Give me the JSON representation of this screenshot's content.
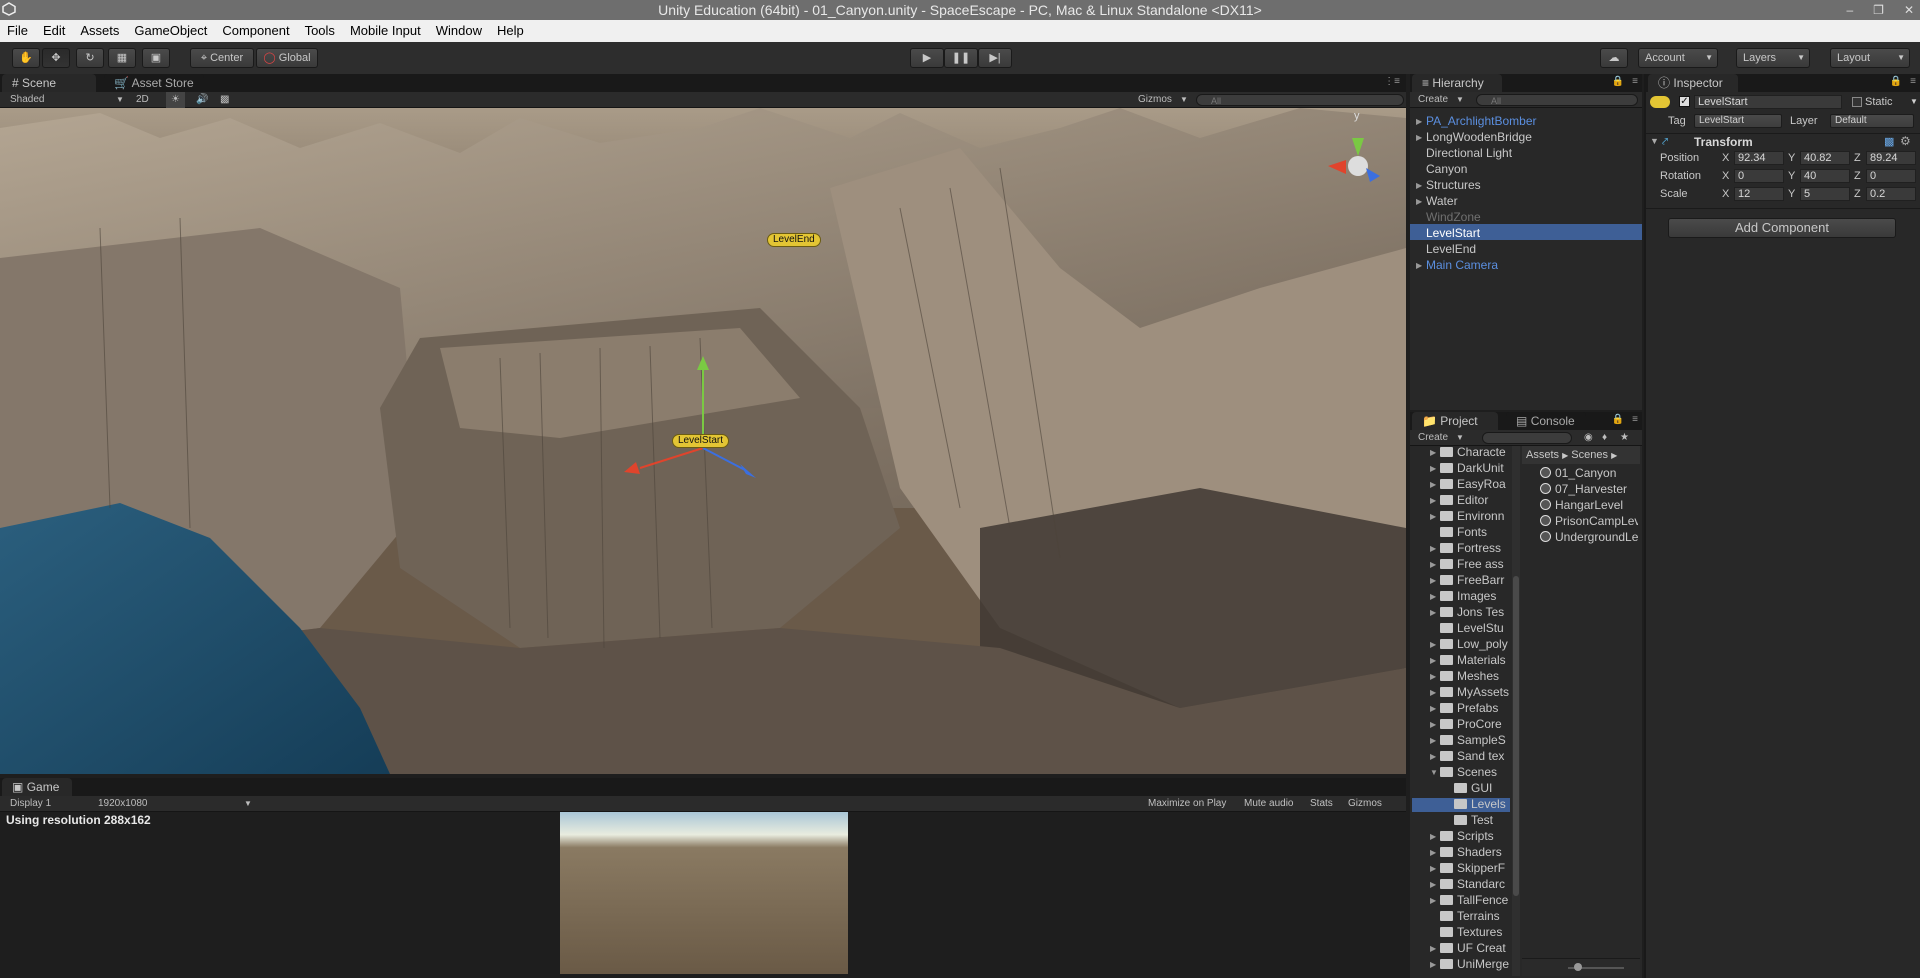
{
  "window": {
    "title": "Unity Education (64bit) - 01_Canyon.unity - SpaceEscape - PC, Mac & Linux Standalone <DX11>"
  },
  "menu": [
    "File",
    "Edit",
    "Assets",
    "GameObject",
    "Component",
    "Tools",
    "Mobile Input",
    "Window",
    "Help"
  ],
  "toolbar": {
    "center": "Center",
    "global": "Global",
    "account": "Account",
    "layers": "Layers",
    "layout": "Layout"
  },
  "scene": {
    "tab_scene": "Scene",
    "tab_store": "Asset Store",
    "shading": "Shaded",
    "mode2d": "2D",
    "gizmos": "Gizmos",
    "search": "All",
    "label_start": "LevelStart",
    "label_end": "LevelEnd",
    "axis_y": "y",
    "tab_menu": "⋮≡"
  },
  "game": {
    "tab": "Game",
    "display": "Display 1",
    "resolution": "1920x1080",
    "maximize": "Maximize on Play",
    "mute": "Mute audio",
    "stats": "Stats",
    "gizmos": "Gizmos",
    "using_res": "Using resolution 288x162"
  },
  "hierarchy": {
    "tab": "Hierarchy",
    "create": "Create",
    "search": "All",
    "items": [
      {
        "label": "PA_ArchlightBomber",
        "style": "blue",
        "arrow": true
      },
      {
        "label": "LongWoodenBridge",
        "style": "",
        "arrow": true
      },
      {
        "label": "Directional Light",
        "style": "",
        "arrow": false
      },
      {
        "label": "Canyon",
        "style": "",
        "arrow": false
      },
      {
        "label": "Structures",
        "style": "",
        "arrow": true
      },
      {
        "label": "Water",
        "style": "",
        "arrow": true
      },
      {
        "label": "WindZone",
        "style": "dim",
        "arrow": false
      },
      {
        "label": "LevelStart",
        "style": "selected",
        "arrow": false
      },
      {
        "label": "LevelEnd",
        "style": "",
        "arrow": false
      },
      {
        "label": "Main Camera",
        "style": "blue",
        "arrow": true
      }
    ]
  },
  "project": {
    "tab": "Project",
    "tab2": "Console",
    "create": "Create",
    "breadcrumb": [
      "Assets",
      "Scenes"
    ],
    "folders": [
      {
        "label": "Characte",
        "arrow": "▶",
        "indent": 0
      },
      {
        "label": "DarkUnit",
        "arrow": "▶",
        "indent": 0
      },
      {
        "label": "EasyRoa",
        "arrow": "▶",
        "indent": 0
      },
      {
        "label": "Editor",
        "arrow": "▶",
        "indent": 0
      },
      {
        "label": "Environn",
        "arrow": "▶",
        "indent": 0
      },
      {
        "label": "Fonts",
        "arrow": "",
        "indent": 0
      },
      {
        "label": "Fortress",
        "arrow": "▶",
        "indent": 0
      },
      {
        "label": "Free ass",
        "arrow": "▶",
        "indent": 0
      },
      {
        "label": "FreeBarr",
        "arrow": "▶",
        "indent": 0
      },
      {
        "label": "Images",
        "arrow": "▶",
        "indent": 0
      },
      {
        "label": "Jons Tes",
        "arrow": "▶",
        "indent": 0
      },
      {
        "label": "LevelStu",
        "arrow": "",
        "indent": 0
      },
      {
        "label": "Low_poly",
        "arrow": "▶",
        "indent": 0
      },
      {
        "label": "Materials",
        "arrow": "▶",
        "indent": 0
      },
      {
        "label": "Meshes",
        "arrow": "▶",
        "indent": 0
      },
      {
        "label": "MyAssets",
        "arrow": "▶",
        "indent": 0
      },
      {
        "label": "Prefabs",
        "arrow": "▶",
        "indent": 0
      },
      {
        "label": "ProCore",
        "arrow": "▶",
        "indent": 0
      },
      {
        "label": "SampleS",
        "arrow": "▶",
        "indent": 0
      },
      {
        "label": "Sand tex",
        "arrow": "▶",
        "indent": 0
      },
      {
        "label": "Scenes",
        "arrow": "▼",
        "indent": 0
      },
      {
        "label": "GUI",
        "arrow": "",
        "indent": 1
      },
      {
        "label": "Levels",
        "arrow": "",
        "indent": 1
      },
      {
        "label": "Test",
        "arrow": "",
        "indent": 1
      },
      {
        "label": "Scripts",
        "arrow": "▶",
        "indent": 0
      },
      {
        "label": "Shaders",
        "arrow": "▶",
        "indent": 0
      },
      {
        "label": "SkipperF",
        "arrow": "▶",
        "indent": 0
      },
      {
        "label": "Standarc",
        "arrow": "▶",
        "indent": 0
      },
      {
        "label": "TallFence",
        "arrow": "▶",
        "indent": 0
      },
      {
        "label": "Terrains",
        "arrow": "",
        "indent": 0
      },
      {
        "label": "Textures",
        "arrow": "",
        "indent": 0
      },
      {
        "label": "UF Creat",
        "arrow": "▶",
        "indent": 0
      },
      {
        "label": "UniMerge",
        "arrow": "▶",
        "indent": 0
      }
    ],
    "files": [
      "01_Canyon",
      "07_Harvester",
      "HangarLevel",
      "PrisonCampLev",
      "UndergroundLe"
    ]
  },
  "inspector": {
    "tab": "Inspector",
    "object_name": "LevelStart",
    "static": "Static",
    "tag_label": "Tag",
    "tag": "LevelStart",
    "layer_label": "Layer",
    "layer": "Default",
    "component": "Transform",
    "rows": [
      {
        "label": "Position",
        "x": "92.34",
        "y": "40.82",
        "z": "89.24"
      },
      {
        "label": "Rotation",
        "x": "0",
        "y": "40",
        "z": "0"
      },
      {
        "label": "Scale",
        "x": "12",
        "y": "5",
        "z": "0.2"
      }
    ],
    "add_component": "Add Component"
  },
  "colors": {
    "selection": "#3e5f96",
    "link_blue": "#5b8fe0",
    "label_yellow": "#e3c534"
  }
}
